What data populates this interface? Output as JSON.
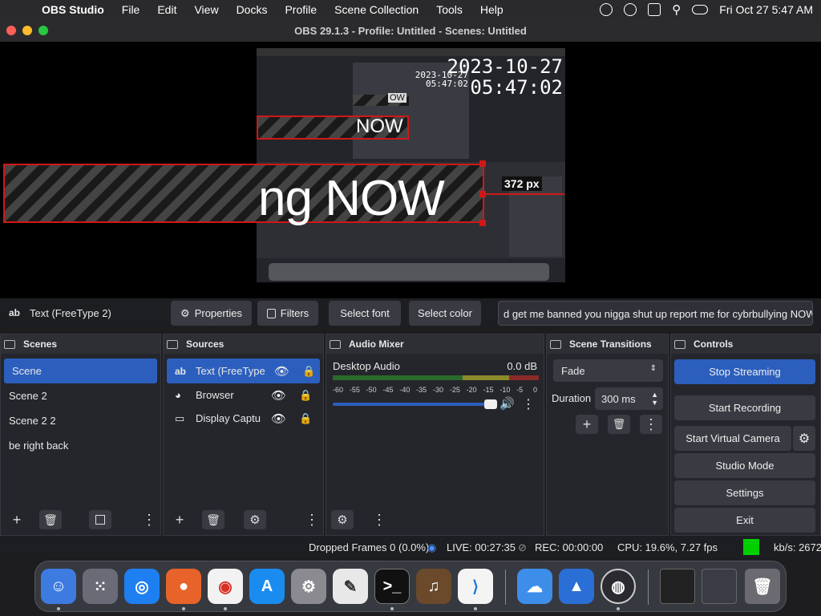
{
  "menubar": {
    "items": [
      "OBS Studio",
      "File",
      "Edit",
      "View",
      "Docks",
      "Profile",
      "Scene Collection",
      "Tools",
      "Help"
    ],
    "clock": "Fri Oct 27  5:47 AM"
  },
  "window": {
    "title": "OBS 29.1.3 - Profile: Untitled - Scenes: Untitled"
  },
  "preview": {
    "date": "2023-10-27",
    "time": "05:47:02",
    "big_text": "ng NOW",
    "small_text": "NOW",
    "tiny_text": "OW",
    "px_label": "372 px"
  },
  "toolbar": {
    "source_icon": "ab",
    "source_name": "Text (FreeType 2)",
    "properties": "Properties",
    "filters": "Filters",
    "select_font": "Select font",
    "select_color": "Select color",
    "text_value": "d get me banned you nigga shut up report me for cybrbullying NOW"
  },
  "scenes": {
    "title": "Scenes",
    "items": [
      "Scene",
      "Scene 2",
      "Scene 2 2",
      "be right back"
    ]
  },
  "sources": {
    "title": "Sources",
    "items": [
      {
        "icon": "ab",
        "label": "Text (FreeType"
      },
      {
        "icon": "globe",
        "label": "Browser"
      },
      {
        "icon": "monitor",
        "label": "Display Captu"
      }
    ]
  },
  "mixer": {
    "title": "Audio Mixer",
    "channel": "Desktop Audio",
    "level": "0.0 dB",
    "ticks": [
      "-60",
      "-55",
      "-50",
      "-45",
      "-40",
      "-35",
      "-30",
      "-25",
      "-20",
      "-15",
      "-10",
      "-5",
      "0"
    ],
    "volume": 1.0
  },
  "transitions": {
    "title": "Scene Transitions",
    "selected": "Fade",
    "duration_label": "Duration",
    "duration_value": "300 ms"
  },
  "controls": {
    "title": "Controls",
    "stop_streaming": "Stop Streaming",
    "start_recording": "Start Recording",
    "start_virtual_camera": "Start Virtual Camera",
    "studio_mode": "Studio Mode",
    "settings": "Settings",
    "exit": "Exit"
  },
  "status": {
    "dropped": "Dropped Frames 0 (0.0%)",
    "live": "LIVE: 00:27:35",
    "rec": "REC: 00:00:00",
    "cpu": "CPU: 19.6%, 7.27 fps",
    "kbs": "kb/s: 2672"
  },
  "colors": {
    "accent": "#2c5fbd",
    "recording_red": "#d01818",
    "status_green": "#00d000"
  }
}
